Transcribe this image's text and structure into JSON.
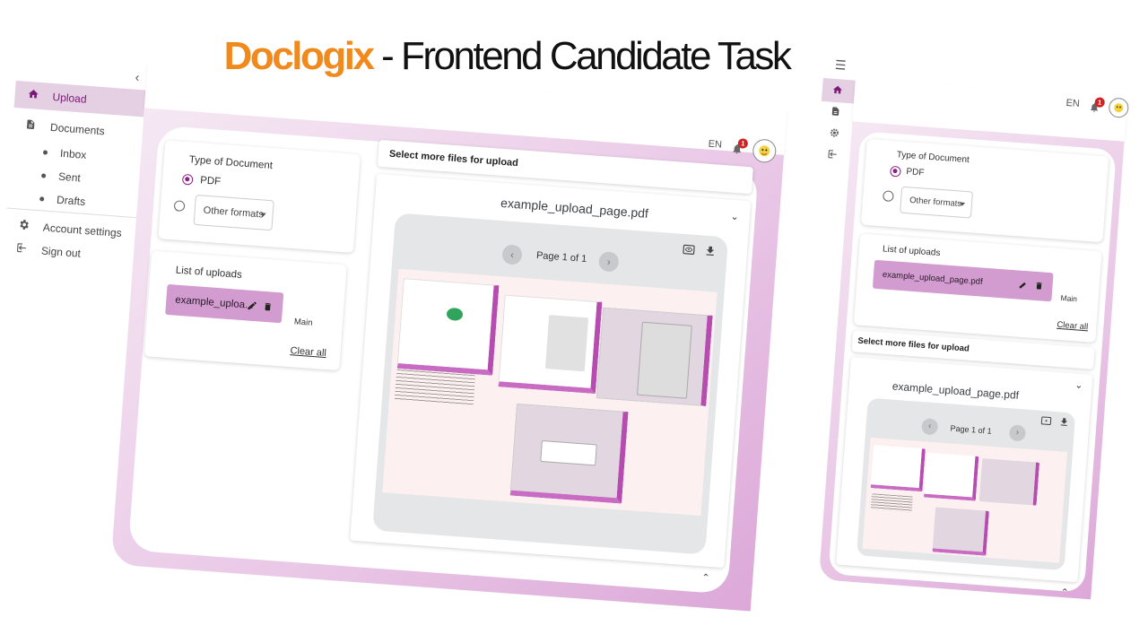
{
  "headline": {
    "brand": "Doclogix",
    "rest": " - Frontend Candidate Task"
  },
  "sidebar": {
    "collapse_icon": "chevron-left-icon",
    "items": [
      {
        "label": "Upload",
        "icon": "home-icon",
        "active": true
      },
      {
        "label": "Documents",
        "icon": "document-icon"
      },
      {
        "label": "Inbox"
      },
      {
        "label": "Sent"
      },
      {
        "label": "Drafts"
      },
      {
        "label": "Account settings",
        "icon": "gear-icon"
      },
      {
        "label": "Sign out",
        "icon": "logout-icon"
      }
    ]
  },
  "header": {
    "lang": "EN",
    "notification_count": "1"
  },
  "type_card": {
    "title": "Type of Document",
    "pdf_label": "PDF",
    "other_formats": "Other formats"
  },
  "uploads_card": {
    "title": "List of uploads",
    "file_truncated": "example_uploa...",
    "file_full": "example_upload_page.pdf",
    "tag": "Main",
    "clear_all": "Clear all"
  },
  "upload_bar": {
    "label": "Select more files for upload"
  },
  "viewer": {
    "file_name": "example_upload_page.pdf",
    "page_label": "Page 1 of 1",
    "prev_icon": "chevron-left-icon",
    "next_icon": "chevron-right-icon"
  },
  "colors": {
    "brand_orange": "#f08a1c",
    "accent_purple": "#8b1f87",
    "chip": "#d39cd0",
    "active_nav": "#e4cfe3",
    "badge": "#d32121"
  }
}
